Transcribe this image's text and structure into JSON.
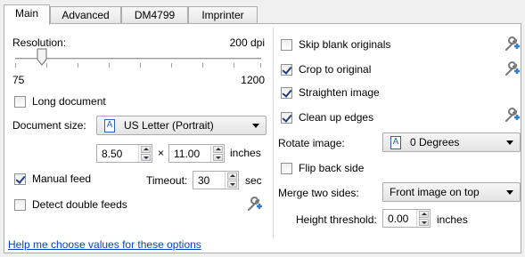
{
  "tabs": [
    {
      "label": "Main",
      "active": true
    },
    {
      "label": "Advanced",
      "active": false
    },
    {
      "label": "DM4799",
      "active": false
    },
    {
      "label": "Imprinter",
      "active": false
    }
  ],
  "resolution": {
    "label": "Resolution:",
    "value_text": "200 dpi",
    "min": "75",
    "max": "1200",
    "slider_fraction": 0.11
  },
  "long_document": {
    "label": "Long document",
    "checked": false
  },
  "document_size": {
    "label": "Document size:",
    "value": "US Letter (Portrait)",
    "icon": "document-icon"
  },
  "dimensions": {
    "width": "8.50",
    "times": "×",
    "height": "11.00",
    "unit": "inches"
  },
  "manual_feed": {
    "label": "Manual feed",
    "checked": true
  },
  "timeout": {
    "label": "Timeout:",
    "value": "30",
    "unit": "sec"
  },
  "detect_double_feeds": {
    "label": "Detect double feeds",
    "checked": false
  },
  "help_link": "Help me choose values for these options",
  "skip_blank": {
    "label": "Skip blank originals",
    "checked": false
  },
  "crop": {
    "label": "Crop to original",
    "checked": true
  },
  "straighten": {
    "label": "Straighten image",
    "checked": true
  },
  "clean_edges": {
    "label": "Clean up edges",
    "checked": true
  },
  "rotate": {
    "label": "Rotate image:",
    "value": "0 Degrees"
  },
  "flip_back": {
    "label": "Flip back side",
    "checked": false
  },
  "merge": {
    "label": "Merge two sides:",
    "value": "Front image on top"
  },
  "height_threshold": {
    "label": "Height threshold:",
    "value": "0.00",
    "unit": "inches"
  },
  "icons": {
    "wrench": "wrench-settings-icon",
    "checkmark": "checkmark-icon",
    "document": "document-icon"
  }
}
